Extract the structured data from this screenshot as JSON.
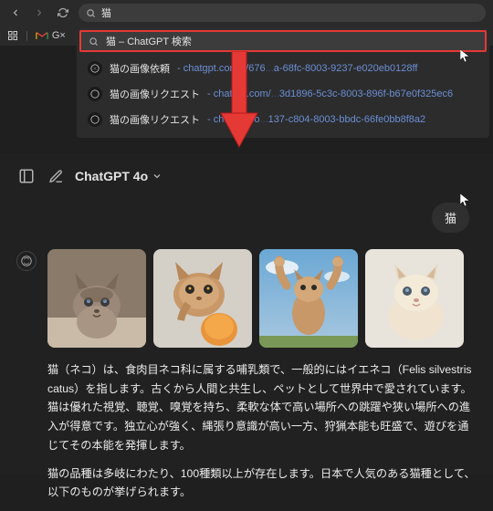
{
  "browser": {
    "url_value": "猫",
    "bookmark_label": "G×"
  },
  "search_dropdown": {
    "query": "猫 – ChatGPT 検索",
    "suggestions": [
      {
        "title": "猫の画像依頼",
        "url": "chatgpt.com/c/676",
        "url_tail": "a-68fc-8003-9237-e020eb0128ff"
      },
      {
        "title": "猫の画像リクエスト",
        "url": "chatgpt.com/",
        "url_tail": "3d1896-5c3c-8003-896f-b67e0f325ec6"
      },
      {
        "title": "猫の画像リクエスト",
        "url": "chatgpt.co",
        "url_tail": "137-c804-8003-bbdc-66fe0bb8f8a2"
      }
    ]
  },
  "chat": {
    "model": "ChatGPT 4o",
    "user_message": "猫",
    "response_p1": "猫（ネコ）は、食肉目ネコ科に属する哺乳類で、一般的にはイエネコ（Felis silvestris catus）を指します。古くから人間と共生し、ペットとして世界中で愛されています。猫は優れた視覚、聴覚、嗅覚を持ち、柔軟な体で高い場所への跳躍や狭い場所への進入が得意です。独立心が強く、縄張り意識が高い一方、狩猟本能も旺盛で、遊びを通じてその本能を発揮します。",
    "response_p2": "猫の品種は多岐にわたり、100種類以上が存在します。日本で人気のある猫種として、以下のものが挙げられます。"
  }
}
